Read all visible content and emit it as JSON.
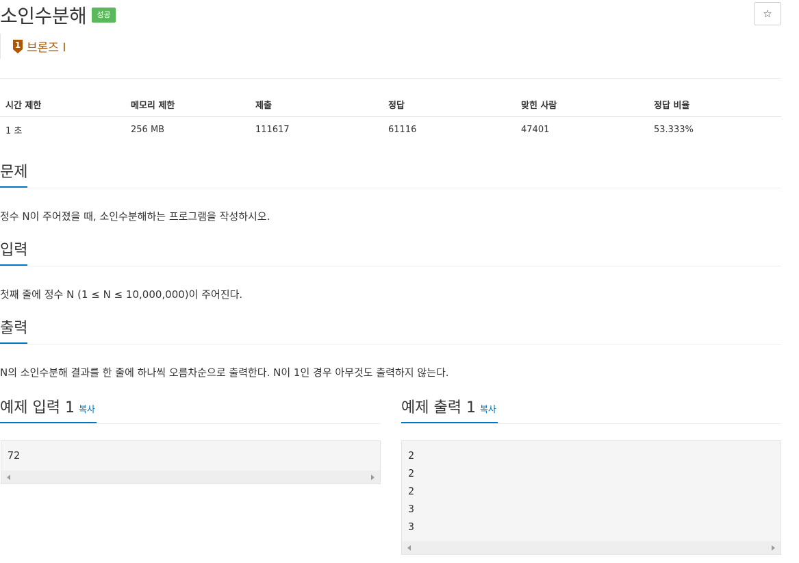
{
  "problem": {
    "title": "소인수분해",
    "status_badge": "성공",
    "star_symbol": "☆",
    "tier": {
      "number": "1",
      "label": "브론즈 I",
      "color": "#ad5600"
    }
  },
  "info": {
    "headers": [
      "시간 제한",
      "메모리 제한",
      "제출",
      "정답",
      "맞힌 사람",
      "정답 비율"
    ],
    "values": [
      "1 초",
      "256 MB",
      "111617",
      "61116",
      "47401",
      "53.333%"
    ]
  },
  "sections": {
    "problem": {
      "title": "문제",
      "text": "정수 N이 주어졌을 때, 소인수분해하는 프로그램을 작성하시오."
    },
    "input": {
      "title": "입력",
      "text": "첫째 줄에 정수 N (1 ≤ N ≤ 10,000,000)이 주어진다."
    },
    "output": {
      "title": "출력",
      "text": "N의 소인수분해 결과를 한 줄에 하나씩 오름차순으로 출력한다. N이 1인 경우 아무것도 출력하지 않는다."
    }
  },
  "samples": {
    "input": {
      "title": "예제 입력 1",
      "copy": "복사",
      "content": "72"
    },
    "output": {
      "title": "예제 출력 1",
      "copy": "복사",
      "content": "2\n2\n2\n3\n3"
    }
  },
  "colors": {
    "accent": "#0076c0",
    "success": "#5cb85c"
  }
}
